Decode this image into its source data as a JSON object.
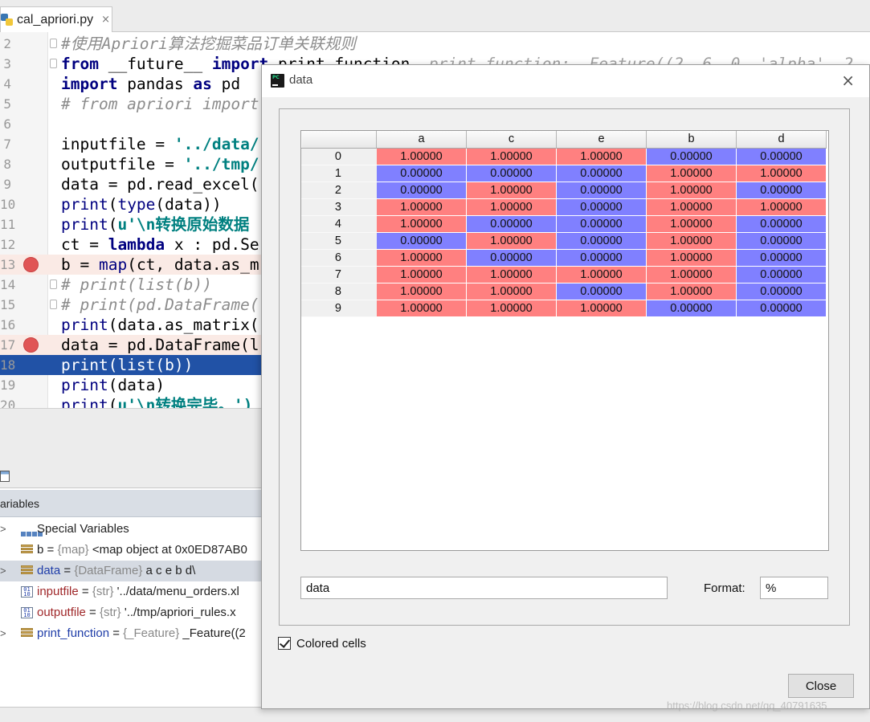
{
  "editor": {
    "tab_name": "cal_apriori.py",
    "tab_close": "×",
    "lines": [
      {
        "n": "2",
        "segs": [
          [
            "com",
            "#使用Apriori算法挖掘菜品订单关联规则"
          ]
        ]
      },
      {
        "n": "3",
        "segs": [
          [
            "kw",
            "from"
          ],
          [
            "plain",
            " __future__ "
          ],
          [
            "kw",
            "import"
          ],
          [
            "plain",
            " print_function"
          ],
          [
            "dim",
            "  print_function: _Feature((2, 6, 0, 'alpha', 2"
          ]
        ]
      },
      {
        "n": "4",
        "segs": [
          [
            "kw",
            "import"
          ],
          [
            "plain",
            " pandas "
          ],
          [
            "kw",
            "as"
          ],
          [
            "plain",
            " pd"
          ]
        ]
      },
      {
        "n": "5",
        "segs": [
          [
            "com",
            "# from apriori import"
          ]
        ]
      },
      {
        "n": "6",
        "segs": []
      },
      {
        "n": "7",
        "segs": [
          [
            "plain",
            "inputfile = "
          ],
          [
            "str",
            "'../data/"
          ]
        ]
      },
      {
        "n": "8",
        "segs": [
          [
            "plain",
            "outputfile = "
          ],
          [
            "str",
            "'../tmp/"
          ]
        ]
      },
      {
        "n": "9",
        "segs": [
          [
            "plain",
            "data = pd.read_excel("
          ]
        ]
      },
      {
        "n": "10",
        "segs": [
          [
            "blt",
            "print"
          ],
          [
            "plain",
            "("
          ],
          [
            "blt",
            "type"
          ],
          [
            "plain",
            "(data))"
          ]
        ]
      },
      {
        "n": "11",
        "segs": [
          [
            "blt",
            "print"
          ],
          [
            "plain",
            "("
          ],
          [
            "str",
            "u'\\n转换原始数据"
          ]
        ]
      },
      {
        "n": "12",
        "segs": [
          [
            "plain",
            "ct = "
          ],
          [
            "kw",
            "lambda"
          ],
          [
            "plain",
            " x : pd.Se"
          ]
        ]
      },
      {
        "n": "13",
        "segs": [
          [
            "plain",
            "b = "
          ],
          [
            "blt",
            "map"
          ],
          [
            "plain",
            "(ct, data.as_m"
          ]
        ]
      },
      {
        "n": "14",
        "segs": [
          [
            "com",
            "# print(list(b))"
          ]
        ]
      },
      {
        "n": "15",
        "segs": [
          [
            "com",
            "# print(pd.DataFrame("
          ]
        ]
      },
      {
        "n": "16",
        "segs": [
          [
            "blt",
            "print"
          ],
          [
            "plain",
            "(data.as_matrix("
          ]
        ]
      },
      {
        "n": "17",
        "segs": [
          [
            "plain",
            "data = pd.DataFrame(l"
          ]
        ]
      },
      {
        "n": "18",
        "segs": [
          [
            "plain",
            "print(list(b))"
          ]
        ]
      },
      {
        "n": "19",
        "segs": [
          [
            "blt",
            "print"
          ],
          [
            "plain",
            "(data)"
          ]
        ]
      },
      {
        "n": "20",
        "segs": [
          [
            "blt",
            "print"
          ],
          [
            "plain",
            "("
          ],
          [
            "str",
            "u'\\n转换完毕。')"
          ]
        ]
      }
    ]
  },
  "variables": {
    "header": "ariables",
    "rows": [
      {
        "name": "Special Variables",
        "type": "",
        "value": ""
      },
      {
        "name": "b",
        "type": "{map}",
        "value": "<map object at 0x0ED87AB0"
      },
      {
        "name": "data",
        "type": "{DataFrame}",
        "value": "    a    c    e    b    d\\"
      },
      {
        "name": "inputfile",
        "type": "{str}",
        "value": "'../data/menu_orders.xl"
      },
      {
        "name": "outputfile",
        "type": "{str}",
        "value": "'../tmp/apriori_rules.x"
      },
      {
        "name": "print_function",
        "type": "{_Feature}",
        "value": "_Feature((2"
      }
    ]
  },
  "dialog": {
    "title": "data",
    "close_glyph": "×",
    "columns": [
      "a",
      "c",
      "e",
      "b",
      "d"
    ],
    "rows": [
      {
        "index": "0",
        "values": [
          "1.00000",
          "1.00000",
          "1.00000",
          "0.00000",
          "0.00000"
        ]
      },
      {
        "index": "1",
        "values": [
          "0.00000",
          "0.00000",
          "0.00000",
          "1.00000",
          "1.00000"
        ]
      },
      {
        "index": "2",
        "values": [
          "0.00000",
          "1.00000",
          "0.00000",
          "1.00000",
          "0.00000"
        ]
      },
      {
        "index": "3",
        "values": [
          "1.00000",
          "1.00000",
          "0.00000",
          "1.00000",
          "1.00000"
        ]
      },
      {
        "index": "4",
        "values": [
          "1.00000",
          "0.00000",
          "0.00000",
          "1.00000",
          "0.00000"
        ]
      },
      {
        "index": "5",
        "values": [
          "0.00000",
          "1.00000",
          "0.00000",
          "1.00000",
          "0.00000"
        ]
      },
      {
        "index": "6",
        "values": [
          "1.00000",
          "0.00000",
          "0.00000",
          "1.00000",
          "0.00000"
        ]
      },
      {
        "index": "7",
        "values": [
          "1.00000",
          "1.00000",
          "1.00000",
          "1.00000",
          "0.00000"
        ]
      },
      {
        "index": "8",
        "values": [
          "1.00000",
          "1.00000",
          "0.00000",
          "1.00000",
          "0.00000"
        ]
      },
      {
        "index": "9",
        "values": [
          "1.00000",
          "1.00000",
          "1.00000",
          "0.00000",
          "0.00000"
        ]
      }
    ],
    "high_color": "#ff8080",
    "low_color": "#8080ff",
    "name_value": "data",
    "format_label": "Format:",
    "format_value": "%",
    "colored_cells_label": "Colored cells",
    "colored_cells_checked": true,
    "close_label": "Close"
  },
  "watermark": "https://blog.csdn.net/qq_40791635"
}
